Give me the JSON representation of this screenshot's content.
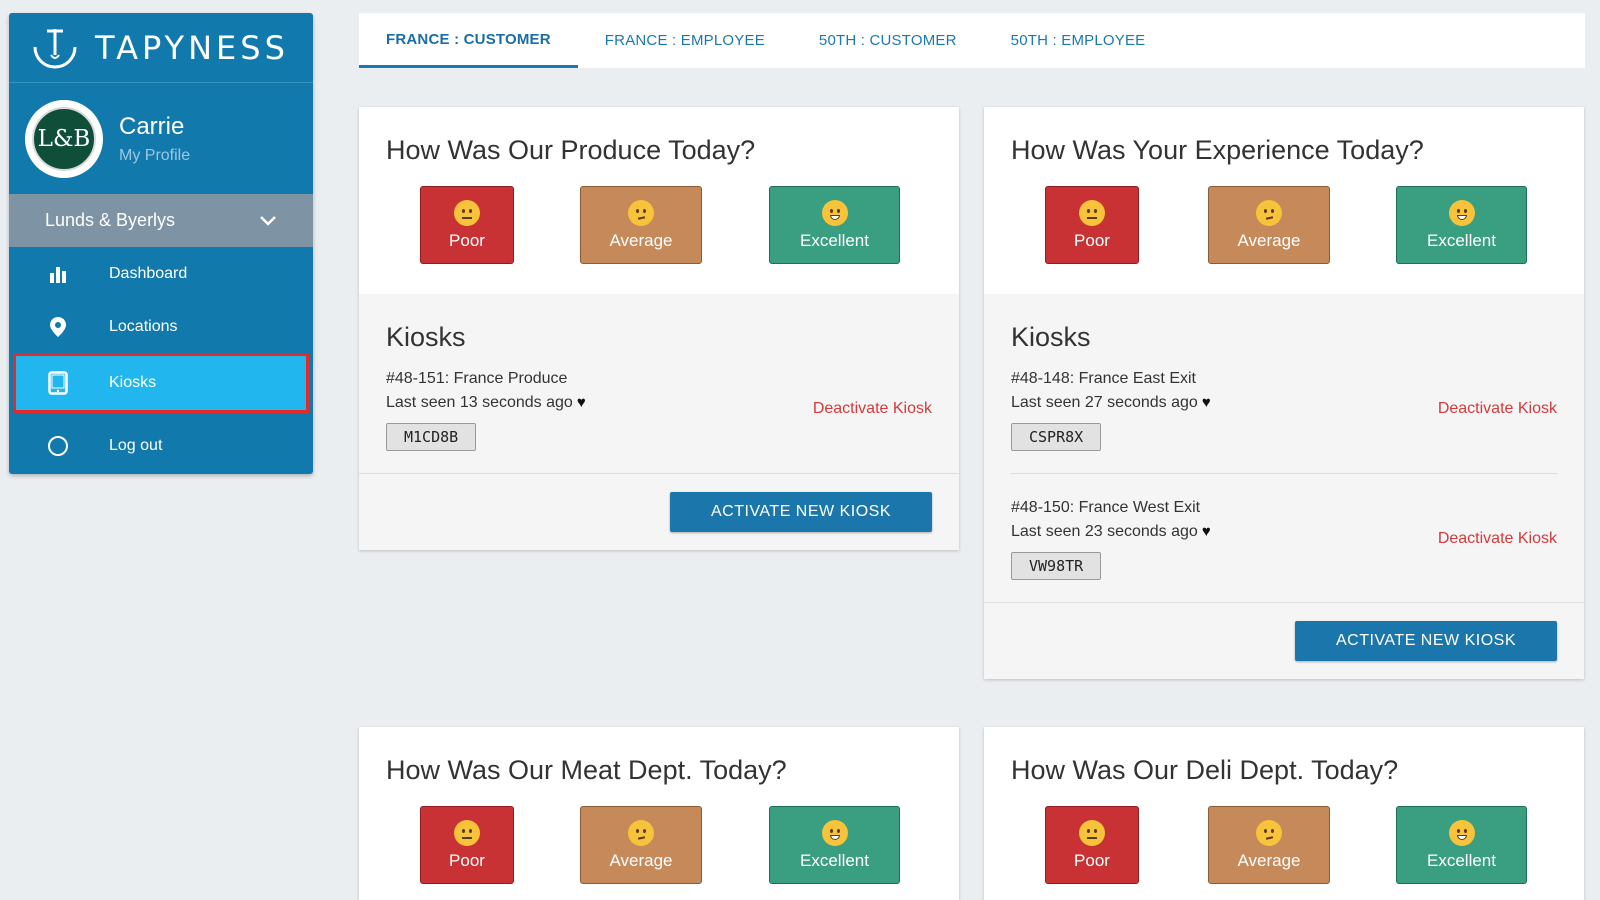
{
  "brand": {
    "name": "TAPYNESS"
  },
  "profile": {
    "name": "Carrie",
    "link": "My Profile",
    "avatar_text": "L&B"
  },
  "org": {
    "name": "Lunds & Byerlys"
  },
  "nav": [
    {
      "label": "Dashboard",
      "icon": "bar-chart-icon"
    },
    {
      "label": "Locations",
      "icon": "map-pin-icon"
    },
    {
      "label": "Kiosks",
      "icon": "tablet-icon",
      "active": true
    },
    {
      "label": "Log out",
      "icon": "circle-icon"
    }
  ],
  "tabs": [
    {
      "label": "FRANCE : CUSTOMER",
      "active": true
    },
    {
      "label": "FRANCE : EMPLOYEE"
    },
    {
      "label": "50TH : CUSTOMER"
    },
    {
      "label": "50TH : EMPLOYEE"
    }
  ],
  "ratings": {
    "poor": "Poor",
    "average": "Average",
    "excellent": "Excellent"
  },
  "kiosks_heading": "Kiosks",
  "deactivate_label": "Deactivate Kiosk",
  "activate_label": "ACTIVATE NEW KIOSK",
  "cards": [
    {
      "title": "How Was Our Produce Today?",
      "kiosks": [
        {
          "name": "#48-151: France Produce",
          "seen": "Last seen 13 seconds ago",
          "code": "M1CD8B"
        }
      ]
    },
    {
      "title": "How Was Your Experience Today?",
      "kiosks": [
        {
          "name": "#48-148: France East Exit",
          "seen": "Last seen 27 seconds ago",
          "code": "CSPR8X"
        },
        {
          "name": "#48-150: France West Exit",
          "seen": "Last seen 23 seconds ago",
          "code": "VW98TR"
        }
      ]
    },
    {
      "title": "How Was Our Meat Dept. Today?"
    },
    {
      "title": "How Was Our Deli Dept. Today?"
    }
  ],
  "colors": {
    "sidebar": "#1279ad",
    "active_nav": "#22b6ee",
    "highlight_border": "#e52a2a",
    "poor": "#c93234",
    "average": "#c5895a",
    "excellent": "#3a9e80",
    "primary_button": "#1b76ac",
    "danger_text": "#d43a3a"
  }
}
